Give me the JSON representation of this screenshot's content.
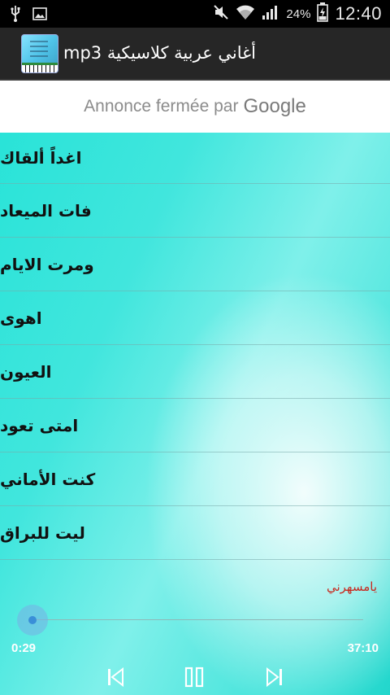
{
  "status_bar": {
    "battery_percent": "24%",
    "time": "12:40",
    "icons": [
      "usb-icon",
      "image-icon",
      "mute-icon",
      "wifi-icon",
      "signal-icon",
      "battery-charging-icon"
    ]
  },
  "app_bar": {
    "title": "أغاني عربية كلاسيكية mp3",
    "icon": "app-logo-icon"
  },
  "ad_banner": {
    "text": "Annonce fermée par",
    "brand": "Google"
  },
  "songs": [
    "اغداً ألقاك",
    "فات الميعاد",
    "ومرت الايام",
    "اهوى",
    "العيون",
    "امتى تعود",
    "كنت الأماني",
    "ليت للبراق"
  ],
  "player": {
    "now_playing": "يامسهرني",
    "current_time": "0:29",
    "total_time": "37:10",
    "progress_fraction": 0.013
  },
  "colors": {
    "accent_cyan": "#29e3d8",
    "now_playing_text": "#c8281e",
    "app_bar_bg": "#262626"
  }
}
